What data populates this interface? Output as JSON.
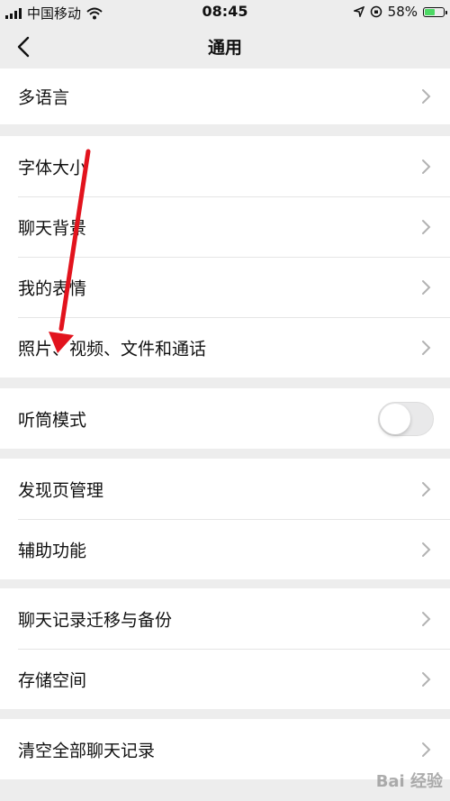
{
  "status_bar": {
    "carrier": "中国移动",
    "time": "08:45",
    "battery": "58%",
    "battery_level": 0.58
  },
  "nav": {
    "title": "通用",
    "back_icon": "chevron-left-icon"
  },
  "groups": [
    {
      "items": [
        "多语言"
      ]
    },
    {
      "items": [
        "字体大小",
        "聊天背景",
        "我的表情",
        "照片、视频、文件和通话"
      ]
    },
    {
      "items": [
        "听筒模式"
      ],
      "toggle_on": false
    },
    {
      "items": [
        "发现页管理",
        "辅助功能"
      ]
    },
    {
      "items": [
        "聊天记录迁移与备份",
        "存储空间"
      ]
    },
    {
      "items": [
        "清空全部聊天记录"
      ]
    }
  ],
  "annotation": {
    "arrow_color": "#e2131d"
  },
  "watermark": "Bai 经验"
}
